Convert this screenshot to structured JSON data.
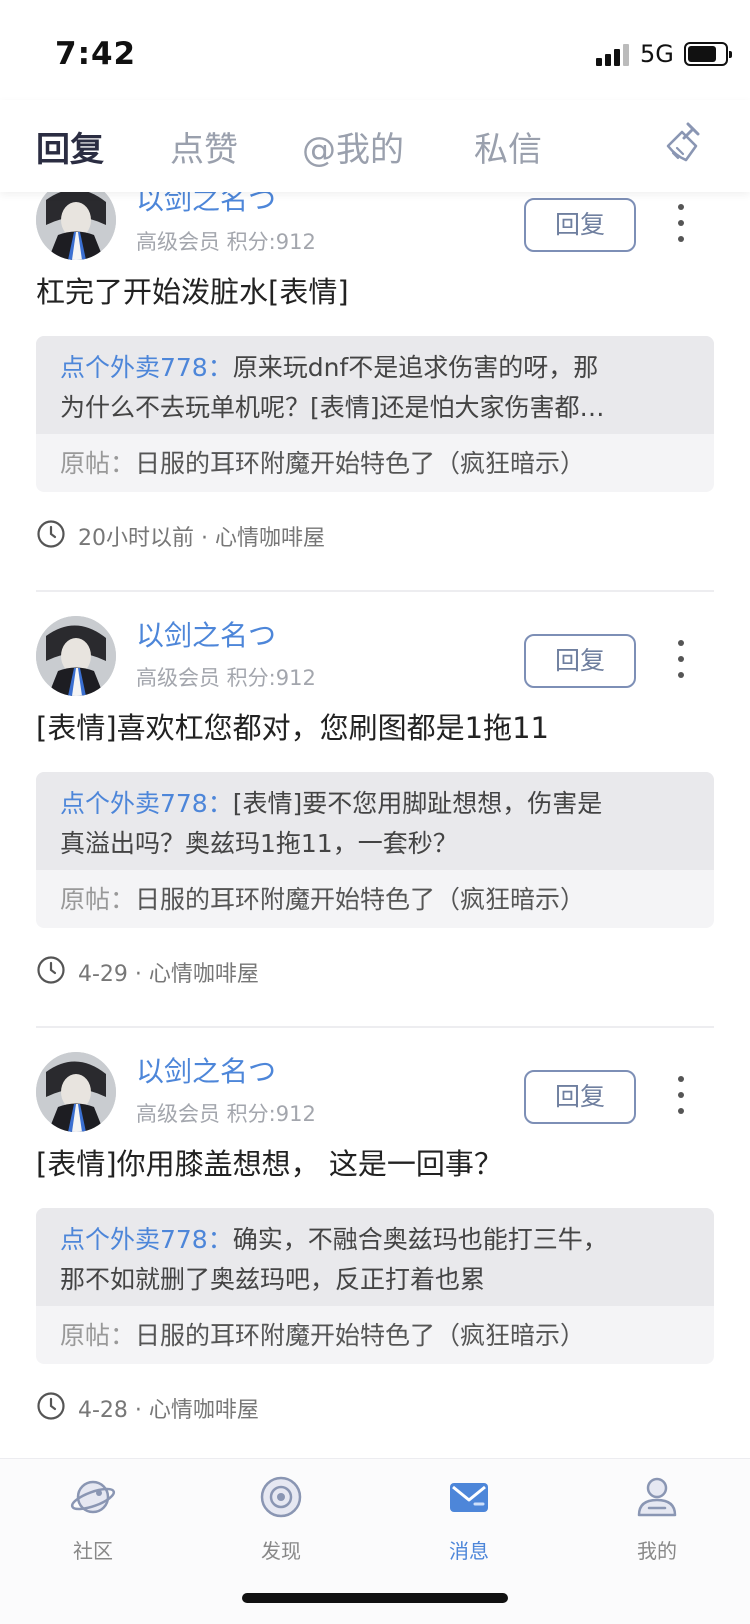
{
  "status_bar": {
    "time": "7:42",
    "network": "5G"
  },
  "tabs": [
    {
      "label": "回复",
      "active": true
    },
    {
      "label": "点赞",
      "active": false
    },
    {
      "label": "@我的",
      "active": false
    },
    {
      "label": "私信",
      "active": false
    }
  ],
  "header_icon": "broom-icon",
  "cards": [
    {
      "user_name": "以剑之名つ",
      "user_meta": "高级会员 积分:912",
      "reply_label": "回复",
      "comment": "杠完了开始泼脏水[表情]",
      "quote_author": "点个外卖778：",
      "quote_line1": "原来玩dnf不是追求伤害的呀，那",
      "quote_line2": "为什么不去玩单机呢？[表情]还是怕大家伤害都…",
      "origin_label": "原帖：",
      "origin_title": "日服的耳环附魔开始特色了（疯狂暗示）",
      "footer": "20小时以前 · 心情咖啡屋"
    },
    {
      "user_name": "以剑之名つ",
      "user_meta": "高级会员 积分:912",
      "reply_label": "回复",
      "comment": "[表情]喜欢杠您都对，您刷图都是1拖11",
      "quote_author": "点个外卖778：",
      "quote_line1": "[表情]要不您用脚趾想想，伤害是",
      "quote_line2": "真溢出吗？奥兹玛1拖11，一套秒？",
      "origin_label": "原帖：",
      "origin_title": "日服的耳环附魔开始特色了（疯狂暗示）",
      "footer": "4-29 · 心情咖啡屋"
    },
    {
      "user_name": "以剑之名つ",
      "user_meta": "高级会员 积分:912",
      "reply_label": "回复",
      "comment": "[表情]你用膝盖想想， 这是一回事？",
      "quote_author": "点个外卖778：",
      "quote_line1": "确实，不融合奥兹玛也能打三牛，",
      "quote_line2": "那不如就删了奥兹玛吧，反正打着也累",
      "origin_label": "原帖：",
      "origin_title": "日服的耳环附魔开始特色了（疯狂暗示）",
      "footer": "4-28 · 心情咖啡屋"
    }
  ],
  "bottom_nav": [
    {
      "label": "社区",
      "icon": "planet-icon",
      "active": false
    },
    {
      "label": "发现",
      "icon": "discover-icon",
      "active": false
    },
    {
      "label": "消息",
      "icon": "mail-icon",
      "active": true
    },
    {
      "label": "我的",
      "icon": "profile-icon",
      "active": false
    }
  ],
  "colors": {
    "accent": "#4d86d9",
    "tab_active": "#2b2d42",
    "tab_inactive": "#9aa0ad"
  }
}
